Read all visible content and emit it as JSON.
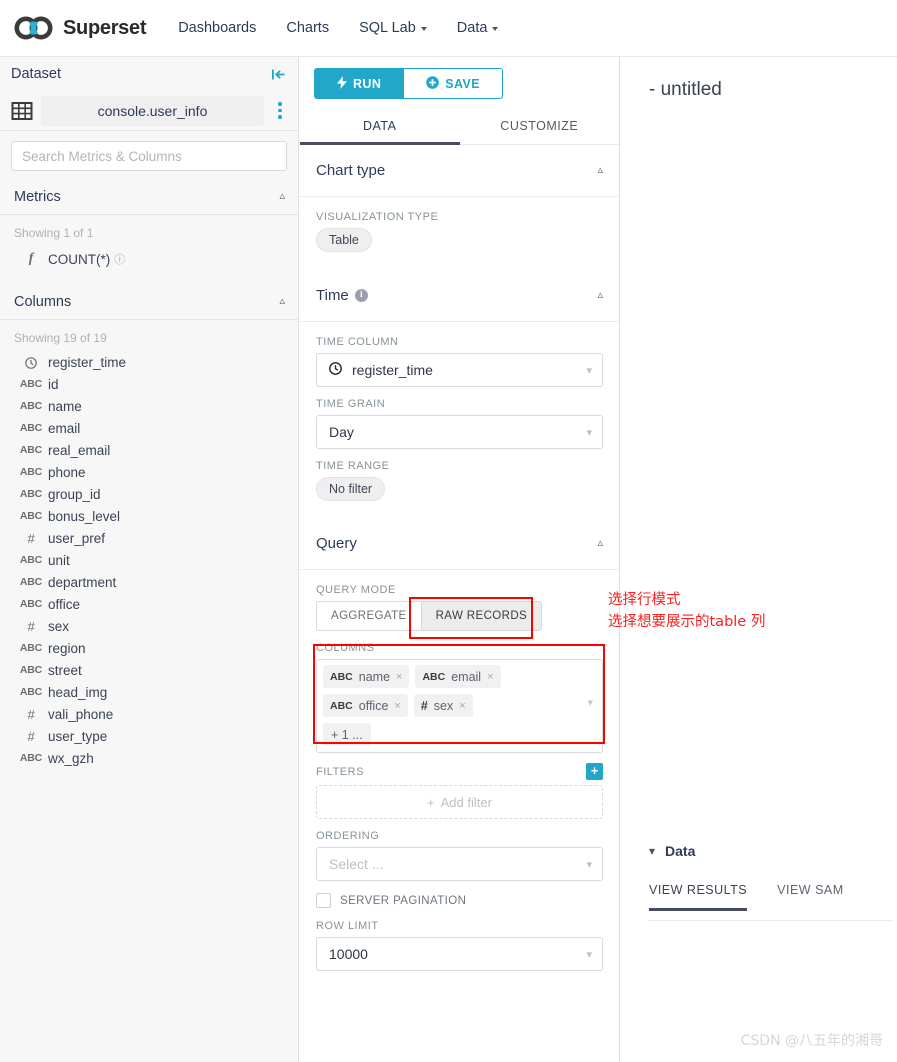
{
  "navbar": {
    "brand": "Superset",
    "links": [
      {
        "label": "Dashboards",
        "caret": false
      },
      {
        "label": "Charts",
        "caret": false
      },
      {
        "label": "SQL Lab",
        "caret": true
      },
      {
        "label": "Data",
        "caret": true
      }
    ]
  },
  "dataset_panel": {
    "title": "Dataset",
    "collapse_icon": "collapse-left-icon",
    "dataset_name": "console.user_info",
    "kebab_icon": "more-options-icon",
    "search_placeholder": "Search Metrics & Columns",
    "search_value": "",
    "metrics": {
      "title": "Metrics",
      "showing": "Showing 1 of 1",
      "items": [
        {
          "type": "f",
          "name": "COUNT(*)",
          "help": "?"
        }
      ]
    },
    "columns": {
      "title": "Columns",
      "showing": "Showing 19 of 19",
      "items": [
        {
          "type": "clock",
          "name": "register_time"
        },
        {
          "type": "ABC",
          "name": "id"
        },
        {
          "type": "ABC",
          "name": "name"
        },
        {
          "type": "ABC",
          "name": "email"
        },
        {
          "type": "ABC",
          "name": "real_email"
        },
        {
          "type": "ABC",
          "name": "phone"
        },
        {
          "type": "ABC",
          "name": "group_id"
        },
        {
          "type": "ABC",
          "name": "bonus_level"
        },
        {
          "type": "#",
          "name": "user_pref"
        },
        {
          "type": "ABC",
          "name": "unit"
        },
        {
          "type": "ABC",
          "name": "department"
        },
        {
          "type": "ABC",
          "name": "office"
        },
        {
          "type": "#",
          "name": "sex"
        },
        {
          "type": "ABC",
          "name": "region"
        },
        {
          "type": "ABC",
          "name": "street"
        },
        {
          "type": "ABC",
          "name": "head_img"
        },
        {
          "type": "#",
          "name": "vali_phone"
        },
        {
          "type": "#",
          "name": "user_type"
        },
        {
          "type": "ABC",
          "name": "wx_gzh"
        }
      ]
    }
  },
  "control_panel": {
    "run_label": "RUN",
    "run_icon": "lightning-icon",
    "save_label": "SAVE",
    "save_icon": "plus-circle-icon",
    "tabs": [
      {
        "label": "DATA",
        "active": true
      },
      {
        "label": "CUSTOMIZE",
        "active": false
      }
    ],
    "chart_type": {
      "title": "Chart type",
      "viz_type_label": "VISUALIZATION TYPE",
      "viz_type_value": "Table"
    },
    "time": {
      "title": "Time",
      "info_icon": "info-icon",
      "time_column_label": "TIME COLUMN",
      "time_column_value": "register_time",
      "time_column_icon": "clock-icon",
      "time_grain_label": "TIME GRAIN",
      "time_grain_value": "Day",
      "time_range_label": "TIME RANGE",
      "time_range_value": "No filter"
    },
    "query": {
      "title": "Query",
      "query_mode_label": "QUERY MODE",
      "modes": [
        {
          "label": "AGGREGATE",
          "active": false
        },
        {
          "label": "RAW RECORDS",
          "active": true
        }
      ],
      "columns_label": "COLUMNS",
      "columns_pills": [
        {
          "type": "ABC",
          "name": "name"
        },
        {
          "type": "ABC",
          "name": "email"
        },
        {
          "type": "ABC",
          "name": "office"
        },
        {
          "type": "#",
          "name": "sex"
        }
      ],
      "columns_more": "+ 1 ...",
      "filters_label": "FILTERS",
      "filters_add_icon": "plus-square-icon",
      "add_filter_label": "Add filter",
      "ordering_label": "ORDERING",
      "ordering_placeholder": "Select ...",
      "server_pagination_label": "SERVER PAGINATION",
      "server_pagination_checked": false,
      "row_limit_label": "ROW LIMIT",
      "row_limit_value": "10000"
    }
  },
  "annotations": {
    "line1": "选择行模式",
    "line2": "选择想要展示的table 列",
    "color": "#ff0000"
  },
  "chart_panel": {
    "title": "- untitled",
    "data_section_label": "Data",
    "data_collapse_icon": "chevron-down-icon",
    "data_tabs": [
      {
        "label": "VIEW RESULTS",
        "active": true
      },
      {
        "label": "VIEW SAM",
        "active": false
      }
    ]
  },
  "watermark": "CSDN @八五年的湘哥",
  "colors": {
    "accent_teal": "#20a7c9",
    "tab_underline": "#484c63",
    "annotation_red": "#ff0000",
    "panel_bg": "#f7f7f7"
  }
}
